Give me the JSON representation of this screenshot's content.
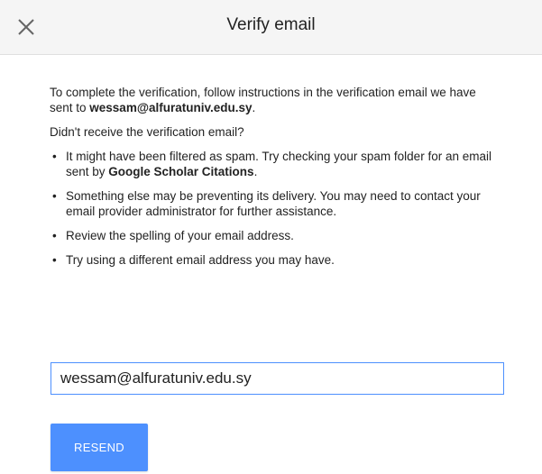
{
  "dialog": {
    "title": "Verify email",
    "close_icon": "close-icon"
  },
  "intro": {
    "text_before": "To complete the verification, follow instructions in the verification email we have sent to ",
    "email": "wessam@alfuratuniv.edu.sy",
    "text_after": "."
  },
  "question": "Didn't receive the verification email?",
  "bullets": [
    {
      "before": "It might have been filtered as spam. Try checking your spam folder for an email sent by ",
      "bold": "Google Scholar Citations",
      "after": "."
    },
    {
      "before": "Something else may be preventing its delivery. You may need to contact your email provider administrator for further assistance.",
      "bold": "",
      "after": ""
    },
    {
      "before": "Review the spelling of your email address.",
      "bold": "",
      "after": ""
    },
    {
      "before": "Try using a different email address you may have.",
      "bold": "",
      "after": ""
    }
  ],
  "email_field": {
    "value": "wessam@alfuratuniv.edu.sy"
  },
  "resend_button": {
    "label": "RESEND"
  },
  "colors": {
    "accent": "#4d90fe",
    "header_bg": "#f5f5f5"
  }
}
